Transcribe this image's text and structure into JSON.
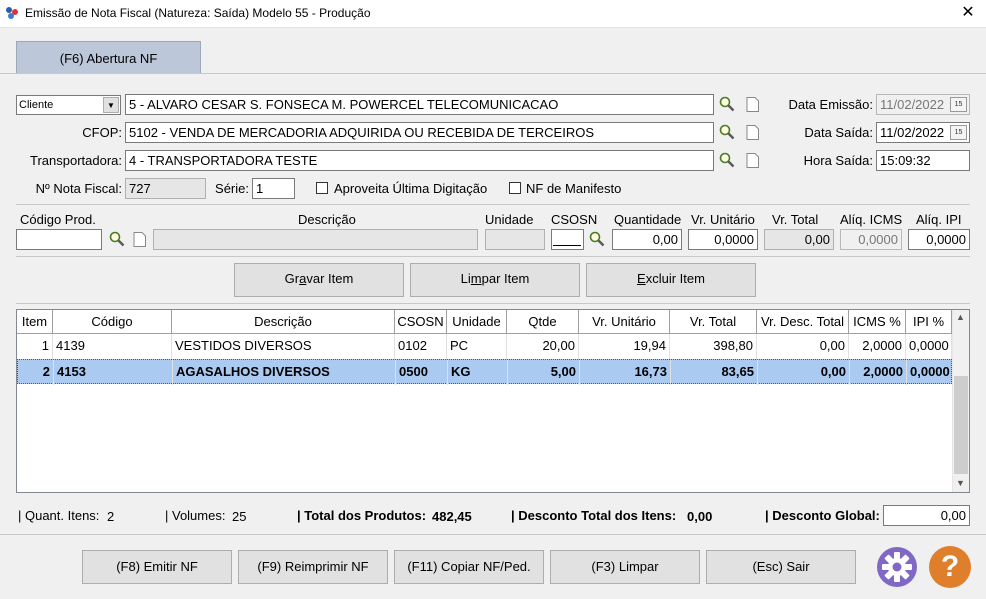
{
  "window": {
    "title": "Emissão de Nota Fiscal (Natureza: Saída) Modelo 55 - Produção",
    "close_label": "✕"
  },
  "tab": {
    "label": "(F6) Abertura NF"
  },
  "header": {
    "cliente_select": "Cliente",
    "cliente_value": "5 - ALVARO CESAR S. FONSECA M. POWERCEL TELECOMUNICACAO",
    "cfop_label": "CFOP:",
    "cfop_value": "5102 - VENDA DE MERCADORIA ADQUIRIDA OU RECEBIDA DE TERCEIROS",
    "transportadora_label": "Transportadora:",
    "transportadora_value": "4 - TRANSPORTADORA TESTE",
    "nota_label": "Nº Nota Fiscal:",
    "nota_value": "727",
    "serie_label": "Série:",
    "serie_value": "1",
    "aproveita_label": "Aproveita Última Digitação",
    "manifesto_label": "NF de Manifesto",
    "data_emissao_label": "Data Emissão:",
    "data_emissao_value": "11/02/2022",
    "data_saida_label": "Data Saída:",
    "data_saida_value": "11/02/2022",
    "hora_saida_label": "Hora Saída:",
    "hora_saida_value": "15:09:32",
    "cal_day": "15"
  },
  "item_form": {
    "codigo_label": "Código Prod.",
    "descricao_label": "Descrição",
    "unidade_label": "Unidade",
    "csosn_label": "CSOSN",
    "quantidade_label": "Quantidade",
    "vr_unitario_label": "Vr. Unitário",
    "vr_total_label": "Vr. Total",
    "aliq_icms_label": "Alíq. ICMS",
    "aliq_ipi_label": "Alíq. IPI",
    "codigo_value": "",
    "descricao_value": "",
    "unidade_value": "",
    "csosn_value": "",
    "quantidade_value": "0,00",
    "vr_unitario_value": "0,0000",
    "vr_total_value": "0,00",
    "aliq_icms_value": "0,0000",
    "aliq_ipi_value": "0,0000"
  },
  "item_buttons": {
    "gravar_pre": "Gr",
    "gravar_key": "a",
    "gravar_post": "var Item",
    "limpar_pre": "Li",
    "limpar_key": "m",
    "limpar_post": "par Item",
    "excluir_pre": "",
    "excluir_key": "E",
    "excluir_post": "xcluir Item"
  },
  "table": {
    "columns": [
      "Item",
      "Código",
      "Descrição",
      "CSOSN",
      "Unidade",
      "Qtde",
      "Vr. Unitário",
      "Vr. Total",
      "Vr. Desc. Total",
      "ICMS %",
      "IPI %"
    ],
    "rows": [
      {
        "item": "1",
        "codigo": "4139",
        "descricao": "VESTIDOS DIVERSOS",
        "csosn": "0102",
        "unidade": "PC",
        "qtde": "20,00",
        "vr_unitario": "19,94",
        "vr_total": "398,80",
        "vr_desc": "0,00",
        "icms": "2,0000",
        "ipi": "0,0000"
      },
      {
        "item": "2",
        "codigo": "4153",
        "descricao": "AGASALHOS DIVERSOS",
        "csosn": "0500",
        "unidade": "KG",
        "qtde": "5,00",
        "vr_unitario": "16,73",
        "vr_total": "83,65",
        "vr_desc": "0,00",
        "icms": "2,0000",
        "ipi": "0,0000"
      }
    ]
  },
  "totals": {
    "quant_itens_label": "| Quant. Itens:",
    "quant_itens_value": "2",
    "volumes_label": "| Volumes:",
    "volumes_value": "25",
    "total_produtos_label": "| Total dos Produtos:",
    "total_produtos_value": "482,45",
    "desconto_itens_label": "| Desconto Total dos Itens:",
    "desconto_itens_value": "0,00",
    "desconto_global_label": "| Desconto Global:",
    "desconto_global_value": "0,00"
  },
  "actions": {
    "emitir": "(F8) Emitir NF",
    "reimprimir": "(F9) Reimprimir NF",
    "copiar": "(F11) Copiar NF/Ped.",
    "limpar": "(F3) Limpar",
    "sair": "(Esc) Sair",
    "help_glyph": "?"
  },
  "colors": {
    "tab": "#bcc8da",
    "selected_row": "#aacaf1",
    "gear": "#7f69c4",
    "help": "#e07f2b"
  }
}
